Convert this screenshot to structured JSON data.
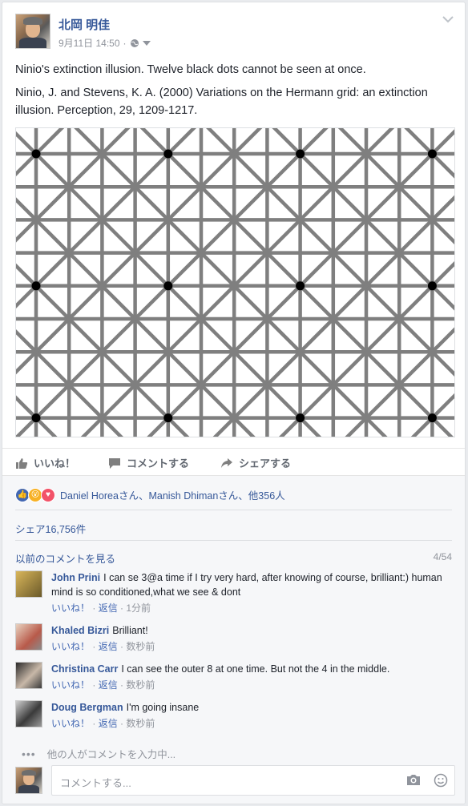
{
  "post": {
    "author": "北岡 明佳",
    "timestamp": "9月11日 14:50",
    "privacy_icon": "globe-icon",
    "paragraph1": "Ninio's extinction illusion. Twelve black dots cannot be seen at once.",
    "paragraph2": "Ninio, J. and Stevens, K. A. (2000) Variations on the Hermann grid: an extinction illusion. Perception, 29, 1209-1217."
  },
  "actions": {
    "like": "いいね！",
    "comment": "コメントする",
    "share": "シェアする"
  },
  "reactions": {
    "text": "Daniel Horeaさん、Manish Dhimanさん、他356人",
    "icons": [
      "like-icon",
      "wow-icon",
      "love-icon"
    ]
  },
  "shares": "シェア16,756件",
  "comments_nav": {
    "previous": "以前のコメントを見る",
    "count": "4/54"
  },
  "comments": [
    {
      "name": "John Prini",
      "text": "I can se 3@a time if I try very hard, after knowing of course, brilliant:) human mind is so conditioned,what we see & dont",
      "like": "いいね！",
      "reply": "返信",
      "time": "1分前"
    },
    {
      "name": "Khaled Bizri",
      "text": "Brilliant!",
      "like": "いいね！",
      "reply": "返信",
      "time": "数秒前"
    },
    {
      "name": "Christina Carr",
      "text": "I can see the outer 8 at one time. But not the 4 in the middle.",
      "like": "いいね！",
      "reply": "返信",
      "time": "数秒前"
    },
    {
      "name": "Doug Bergman",
      "text": "I'm going insane",
      "like": "いいね！",
      "reply": "返信",
      "time": "数秒前"
    }
  ],
  "typing": "他の人がコメントを入力中...",
  "composer": {
    "placeholder": "コメントする..."
  },
  "colors": {
    "link": "#365899",
    "grid_line": "#7f7f7f",
    "dot": "#000000"
  }
}
